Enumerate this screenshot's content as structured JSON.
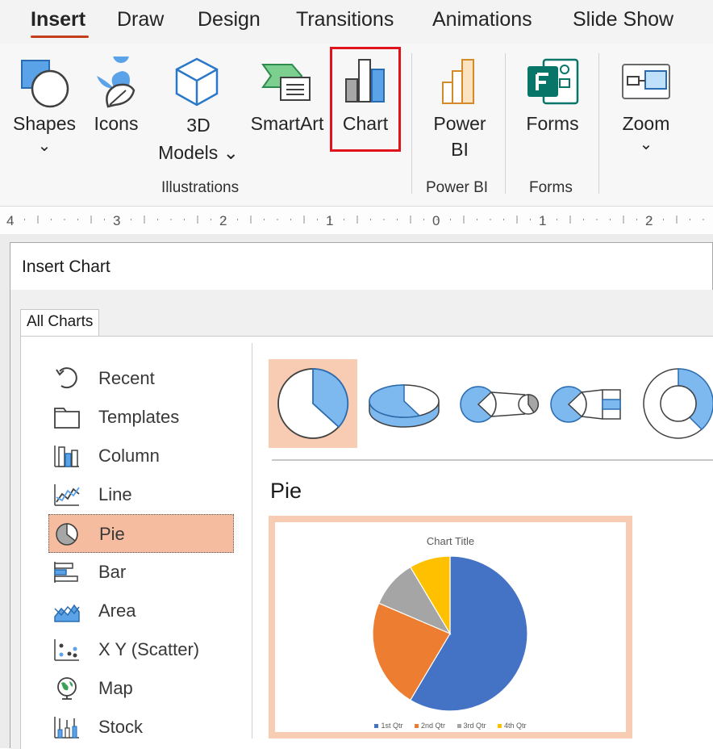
{
  "tabs": [
    {
      "label": "Insert",
      "active": true
    },
    {
      "label": "Draw"
    },
    {
      "label": "Design"
    },
    {
      "label": "Transitions"
    },
    {
      "label": "Animations"
    },
    {
      "label": "Slide Show"
    }
  ],
  "ribbon": {
    "shapes": {
      "line1": "Shapes",
      "chevron": "⌄"
    },
    "icons": {
      "label": "Icons"
    },
    "models": {
      "line1": "3D",
      "line2": "Models ⌄"
    },
    "smartart": {
      "label": "SmartArt"
    },
    "chart": {
      "label": "Chart"
    },
    "powerbi": {
      "line1": "Power",
      "line2": "BI"
    },
    "forms": {
      "label": "Forms"
    },
    "zoom": {
      "label": "Zoom",
      "chevron": "⌄"
    },
    "groups": {
      "illustrations": "Illustrations",
      "powerbi": "Power BI",
      "forms": "Forms"
    }
  },
  "ruler": {
    "numbers": [
      "4",
      "3",
      "2",
      "1",
      "0",
      "1",
      "2"
    ]
  },
  "dialog": {
    "title": "Insert Chart",
    "tab": "All Charts",
    "categories": [
      {
        "label": "Recent",
        "icon": "recent-icon"
      },
      {
        "label": "Templates",
        "icon": "templates-icon"
      },
      {
        "label": "Column",
        "icon": "column-chart-icon"
      },
      {
        "label": "Line",
        "icon": "line-chart-icon"
      },
      {
        "label": "Pie",
        "icon": "pie-chart-icon",
        "selected": true
      },
      {
        "label": "Bar",
        "icon": "bar-chart-icon"
      },
      {
        "label": "Area",
        "icon": "area-chart-icon"
      },
      {
        "label": "X Y (Scatter)",
        "icon": "scatter-chart-icon"
      },
      {
        "label": "Map",
        "icon": "map-chart-icon"
      },
      {
        "label": "Stock",
        "icon": "stock-chart-icon"
      }
    ],
    "subtypes": [
      "pie",
      "3d-pie",
      "pie-of-pie",
      "bar-of-pie",
      "doughnut"
    ],
    "selected_subtype": "Pie"
  },
  "chart_data": {
    "type": "pie",
    "title": "Chart Title",
    "categories": [
      "1st Qtr",
      "2nd Qtr",
      "3rd Qtr",
      "4th Qtr"
    ],
    "values": [
      8.2,
      3.2,
      1.4,
      1.2
    ],
    "colors": [
      "#4472c4",
      "#ed7d31",
      "#a5a5a5",
      "#ffc000"
    ]
  }
}
